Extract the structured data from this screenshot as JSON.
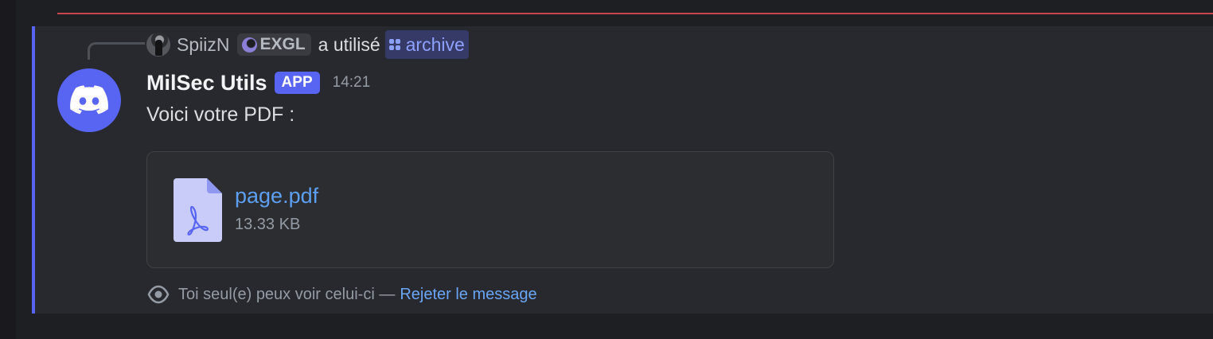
{
  "reply": {
    "username": "SpiizN",
    "guild_tag": "EXGL",
    "action_text": "a utilisé",
    "command": "archive"
  },
  "message": {
    "author": "MilSec Utils",
    "badge": "APP",
    "timestamp": "14:21",
    "content": "Voici votre PDF :"
  },
  "attachment": {
    "file_name": "page.pdf",
    "file_size": "13.33 KB",
    "icon": "pdf-file-icon"
  },
  "ephemeral": {
    "notice": "Toi seul(e) peux voir celui-ci —",
    "dismiss_link": "Rejeter le message"
  },
  "colors": {
    "background": "#1e1f22",
    "message_highlight": "#28292e",
    "accent": "#5865f2",
    "unread_divider": "#c8464a",
    "link": "#6aa6f5",
    "command_text": "#8fa1ff"
  }
}
